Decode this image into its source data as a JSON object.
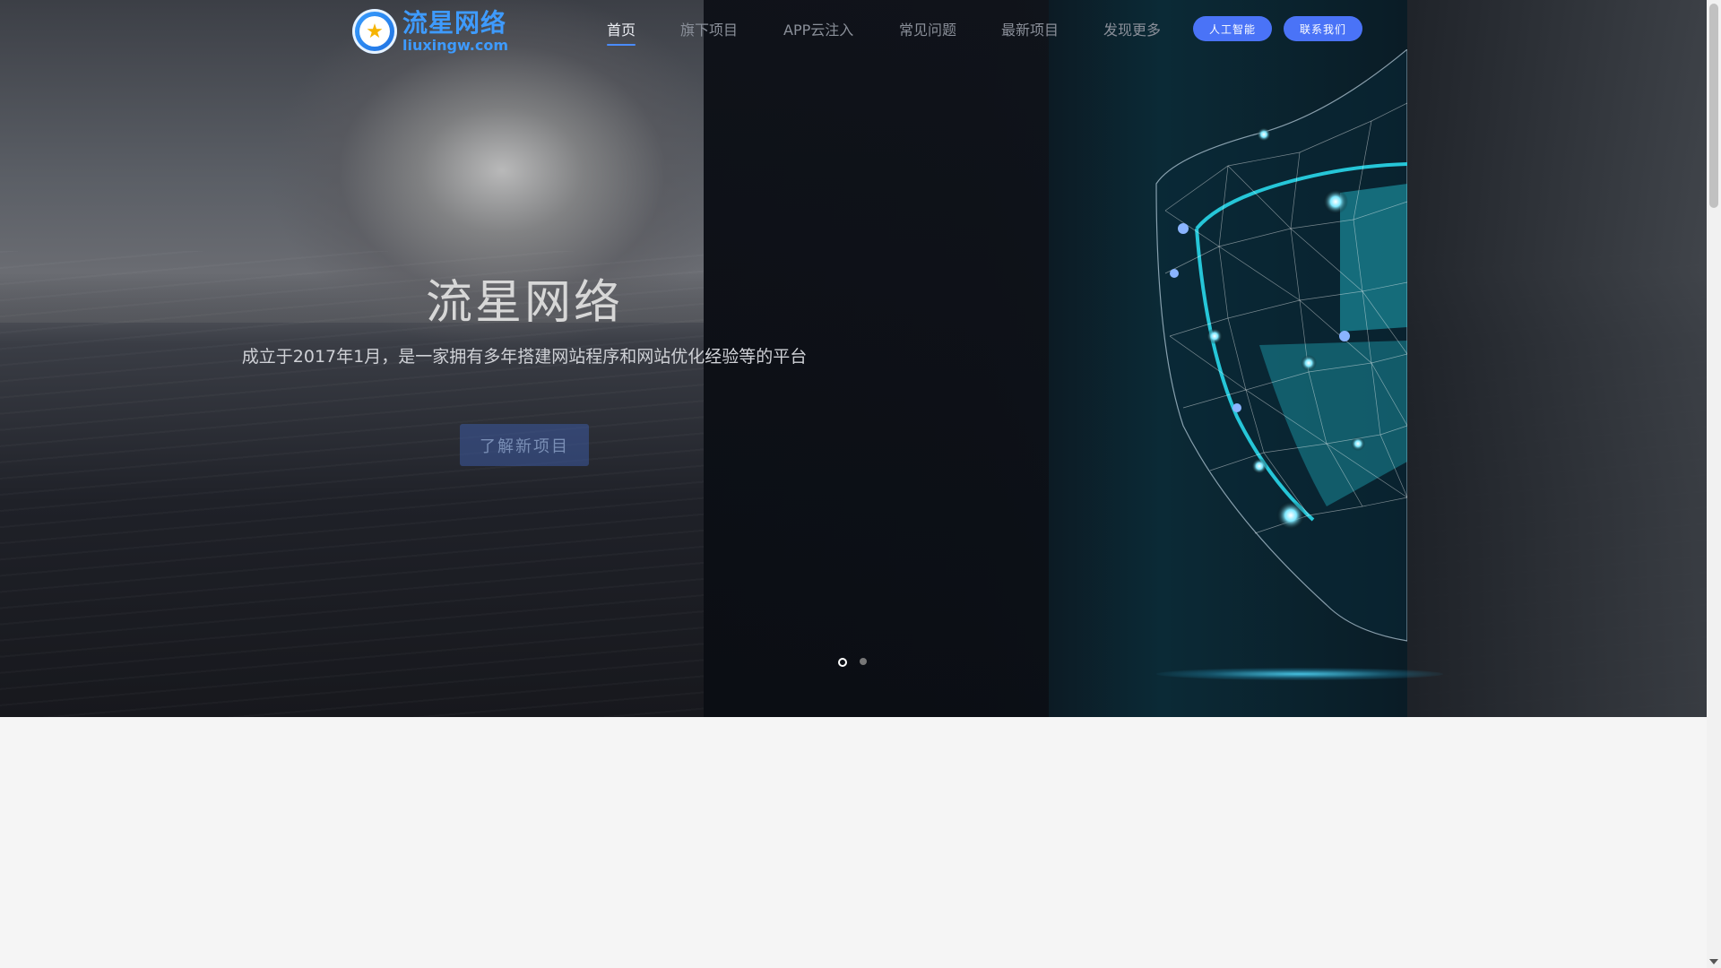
{
  "brand": {
    "logo_cn": "流星网络",
    "logo_en": "liuxingw.com"
  },
  "nav": {
    "items": [
      {
        "label": "首页",
        "active": true
      },
      {
        "label": "旗下项目",
        "active": false
      },
      {
        "label": "APP云注入",
        "active": false
      },
      {
        "label": "常见问题",
        "active": false
      },
      {
        "label": "最新项目",
        "active": false
      },
      {
        "label": "发现更多",
        "active": false
      }
    ],
    "buttons": [
      {
        "label": "人工智能"
      },
      {
        "label": "联系我们"
      }
    ]
  },
  "hero": {
    "title": "流星网络",
    "subtitle": "成立于2017年1月，是一家拥有多年搭建网站程序和网站优化经验等的平台",
    "cta": "了解新项目",
    "slides_count": 2,
    "active_slide": 1
  },
  "colors": {
    "accent": "#4a73f7",
    "brand": "#3e9bff"
  }
}
